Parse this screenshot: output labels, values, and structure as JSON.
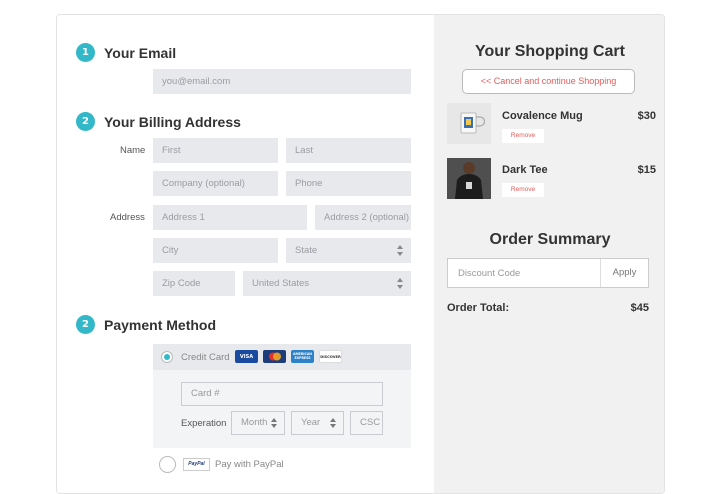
{
  "email_section": {
    "step": "1",
    "title": "Your Email",
    "email_placeholder": "you@email.com"
  },
  "billing_section": {
    "step": "2",
    "title": "Your Billing Address",
    "name_label": "Name",
    "address_label": "Address",
    "first_placeholder": "First",
    "last_placeholder": "Last",
    "company_placeholder": "Company (optional)",
    "phone_placeholder": "Phone",
    "address1_placeholder": "Address 1",
    "address2_placeholder": "Address 2 (optional)",
    "city_placeholder": "City",
    "state_value": "State",
    "zip_placeholder": "Zip Code",
    "country_value": "United States"
  },
  "payment_section": {
    "step": "2",
    "title": "Payment Method",
    "credit_card_label": "Credit Card",
    "card_logos": [
      "VISA",
      "mastercard",
      "AMERICAN EXPRESS",
      "DISCOVER"
    ],
    "card_number_placeholder": "Card #",
    "expiration_label": "Experation",
    "month_value": "Month",
    "year_value": "Year",
    "csc_placeholder": "CSC",
    "paypal_badge": "PayPal",
    "paypal_label": "Pay with PayPal"
  },
  "cart": {
    "title": "Your Shopping Cart",
    "cancel_label": "<< Cancel and continue Shopping",
    "items": [
      {
        "name": "Covalence Mug",
        "price": "$30",
        "remove_label": "Remove"
      },
      {
        "name": "Dark Tee",
        "price": "$15",
        "remove_label": "Remove"
      }
    ]
  },
  "summary": {
    "title": "Order Summary",
    "discount_placeholder": "Discount Code",
    "apply_label": "Apply",
    "total_label": "Order Total:",
    "total_value": "$45"
  },
  "colors": {
    "accent": "#33b8c9",
    "danger": "#e55a5a",
    "field_bg": "#e8e9ec",
    "panel_bg": "#f1f1f1"
  }
}
